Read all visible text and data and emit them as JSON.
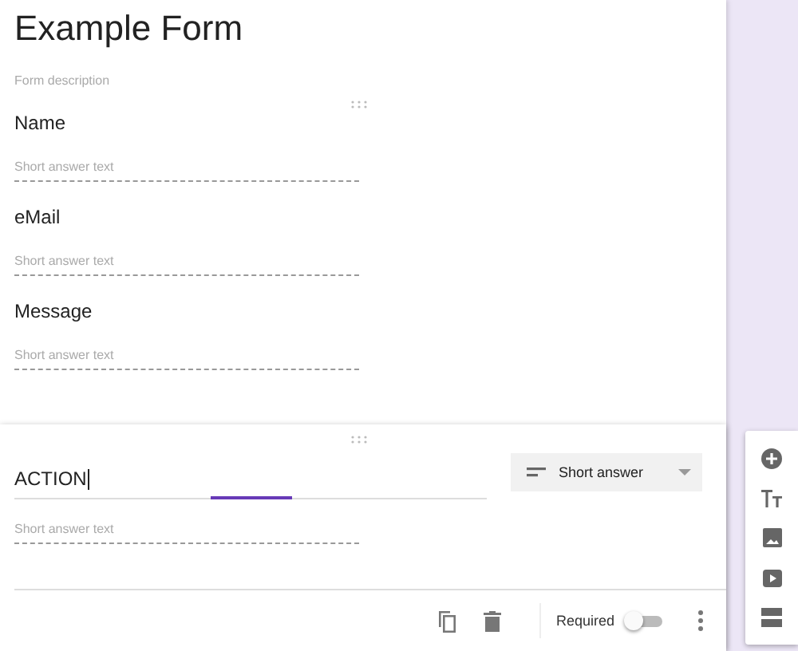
{
  "form": {
    "title": "Example Form",
    "description_placeholder": "Form description"
  },
  "questions": [
    {
      "label": "Name",
      "placeholder": "Short answer text"
    },
    {
      "label": "eMail",
      "placeholder": "Short answer text"
    },
    {
      "label": "Message",
      "placeholder": "Short answer text"
    }
  ],
  "active_question": {
    "title": "ACTION",
    "type": "Short answer",
    "placeholder": "Short answer text",
    "required_label": "Required",
    "required": false
  }
}
